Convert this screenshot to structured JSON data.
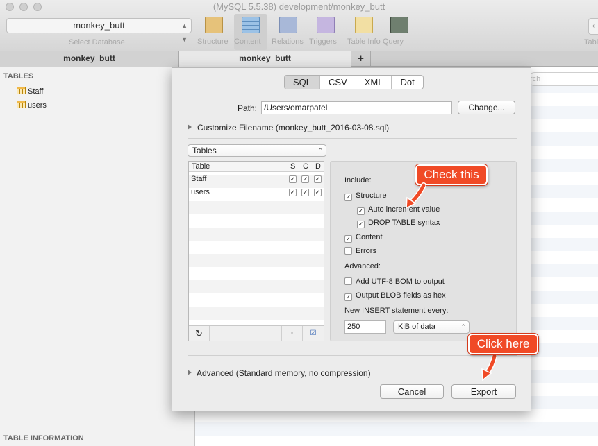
{
  "window": {
    "title": "(MySQL 5.5.38) development/monkey_butt"
  },
  "toolbar": {
    "database_value": "monkey_butt",
    "database_caption": "Select Database",
    "tools": [
      {
        "label": "Structure",
        "icon": "structure-icon",
        "color": "#e6c27a"
      },
      {
        "label": "Content",
        "icon": "content-icon",
        "color": "#9cc2e6"
      },
      {
        "label": "Relations",
        "icon": "relations-icon",
        "color": "#a8b8d8"
      },
      {
        "label": "Triggers",
        "icon": "triggers-icon",
        "color": "#c5b6e0"
      },
      {
        "label": "Table Info",
        "icon": "table-info-icon",
        "color": "#f2dfa3"
      },
      {
        "label": "Query",
        "icon": "query-icon",
        "color": "#6f7f6f"
      }
    ],
    "right_caption": "Tabl"
  },
  "tabs": {
    "left": "monkey_butt",
    "main": "monkey_butt",
    "add": "+"
  },
  "sidebar": {
    "tables_heading": "TABLES",
    "tables": [
      "Staff",
      "users"
    ],
    "info_heading": "TABLE INFORMATION"
  },
  "content": {
    "search_ghost": "rch"
  },
  "export": {
    "formats": [
      "SQL",
      "CSV",
      "XML",
      "Dot"
    ],
    "selected_format": "SQL",
    "path_label": "Path:",
    "path_value": "/Users/omarpatel",
    "change_button": "Change...",
    "customize_filename": "Customize Filename (monkey_butt_2016-03-08.sql)",
    "source_select": "Tables",
    "list_columns": {
      "table": "Table",
      "s": "S",
      "c": "C",
      "d": "D"
    },
    "list_rows": [
      {
        "name": "Staff",
        "s": true,
        "c": true,
        "d": true
      },
      {
        "name": "users",
        "s": true,
        "c": true,
        "d": true
      }
    ],
    "include_label": "Include:",
    "options": {
      "structure": {
        "label": "Structure",
        "checked": true
      },
      "auto_increment": {
        "label": "Auto increment value",
        "checked": true
      },
      "drop_table": {
        "label": "DROP TABLE syntax",
        "checked": true
      },
      "content": {
        "label": "Content",
        "checked": true
      },
      "errors": {
        "label": "Errors",
        "checked": false
      }
    },
    "advanced_label": "Advanced:",
    "advanced_options": {
      "utf8_bom": {
        "label": "Add UTF-8 BOM to output",
        "checked": false
      },
      "blob_hex": {
        "label": "Output BLOB fields as hex",
        "checked": true
      }
    },
    "insert_every_label": "New INSERT statement every:",
    "insert_every_value": "250",
    "insert_unit": "KiB of data",
    "advanced_disclosure": "Advanced (Standard memory, no compression)",
    "cancel_button": "Cancel",
    "export_button": "Export"
  },
  "annotations": {
    "check_this": "Check this",
    "click_here": "Click here",
    "color": "#f04a26"
  }
}
